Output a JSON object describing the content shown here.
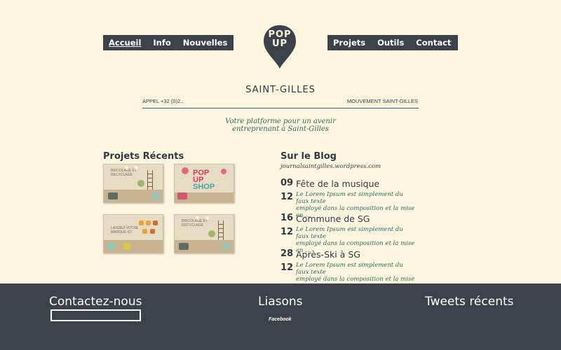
{
  "nav": {
    "left": [
      {
        "label": "Accueil",
        "active": true
      },
      {
        "label": "Info",
        "active": false
      },
      {
        "label": "Nouvelles",
        "active": false
      }
    ],
    "right": [
      {
        "label": "Projets"
      },
      {
        "label": "Outils"
      },
      {
        "label": "Contact"
      }
    ]
  },
  "logo": {
    "line1": "POP",
    "line2": "UP",
    "icon": "map-pin-icon"
  },
  "header": {
    "city": "SAINT-GILLES",
    "phone": "APPEL +32 (0)2..",
    "movement": "MOUVEMENT SAINT-GILLES",
    "tagline_line1": "Votre platforme pour un avenir",
    "tagline_line2": "entreprenant à Saint-Gilles"
  },
  "projects": {
    "title": "Projets Récents",
    "thumb_texts": {
      "sign1": "BRICOLAGE ET RECYCLAGE",
      "shop1": "POP",
      "shop2": "UP",
      "shop3": "SHOP",
      "sign3": "LAISSEZ VOTRE MARQUE ICI"
    }
  },
  "blog": {
    "title": "Sur le Blog",
    "link": "journalsaintgilles.wordpress.com",
    "posts": [
      {
        "day": "09",
        "month": "12",
        "title": "Fête de la musique",
        "excerpt_line1": "Le Lorem Ipsum est simplement du faux texte",
        "excerpt_line2": "employé dans la composition et la mise en ..."
      },
      {
        "day": "16",
        "month": "12",
        "title": "Commune de SG",
        "excerpt_line1": "Le Lorem Ipsum est simplement du faux texte",
        "excerpt_line2": "employé dans la composition et la mise en ..."
      },
      {
        "day": "28",
        "month": "12",
        "title": "Après-Ski à SG",
        "excerpt_line1": "Le Lorem Ipsum est simplement du faux texte",
        "excerpt_line2": "employé dans la composition et la mise en ..."
      }
    ]
  },
  "footer": {
    "contact_title": "Contactez-nous",
    "links_title": "Liasons",
    "links_facebook": "Facebook",
    "tweets_title": "Tweets récents"
  },
  "colors": {
    "background": "#fdf5e0",
    "dark": "#3b4249",
    "accent_green": "#2e6b5a"
  }
}
